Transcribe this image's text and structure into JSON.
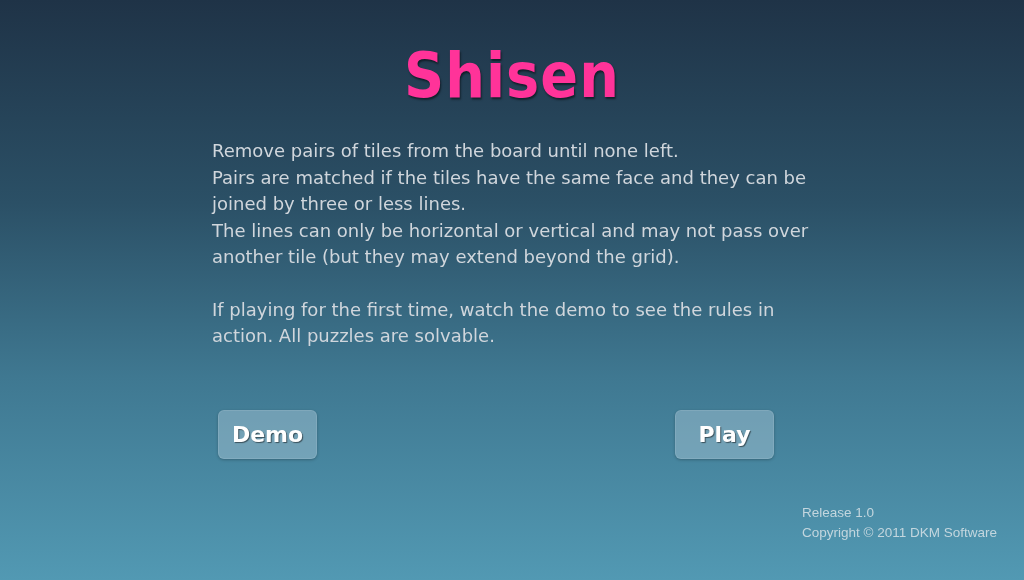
{
  "title": "Shisen",
  "rules": [
    "Remove pairs of tiles from the board until none left.",
    "Pairs are matched if the tiles have the same face and they can be joined by three or less lines.",
    "The lines can only be horizontal or vertical and may not pass over another tile (but they may extend beyond the grid)."
  ],
  "hint": "If playing for the first time, watch the demo to see the rules in action. All puzzles are solvable.",
  "buttons": [
    {
      "label": "Demo"
    },
    {
      "label": "Play"
    }
  ],
  "footer": {
    "release": "Release 1.0",
    "copyright": "Copyright © 2011 DKM Software"
  }
}
